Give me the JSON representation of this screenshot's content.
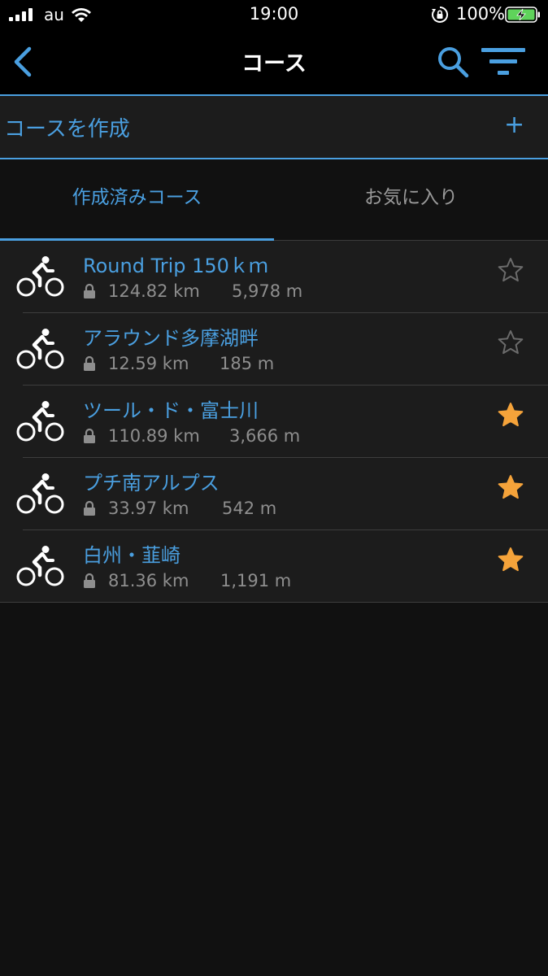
{
  "status_bar": {
    "carrier": "au",
    "time": "19:00",
    "battery_percent": "100%",
    "battery_level": 1.0,
    "icons": [
      "signal-icon",
      "wifi-icon",
      "orientation-lock-icon",
      "battery-charging-icon"
    ]
  },
  "nav": {
    "title": "コース",
    "icons": [
      "back-chevron-icon",
      "search-icon",
      "filter-icon"
    ]
  },
  "create": {
    "label": "コースを作成",
    "plus": "+"
  },
  "tabs": [
    {
      "label": "作成済みコース",
      "active": true
    },
    {
      "label": "お気に入り",
      "active": false
    }
  ],
  "courses": [
    {
      "name": "Round Trip 150ｋｍ",
      "distance": "124.82 km",
      "elevation": "5,978 m",
      "favorite": false
    },
    {
      "name": "アラウンド多摩湖畔",
      "distance": "12.59 km",
      "elevation": "185 m",
      "favorite": false
    },
    {
      "name": "ツール・ド・富士川",
      "distance": "110.89 km",
      "elevation": "3,666 m",
      "favorite": true
    },
    {
      "name": "プチ南アルプス",
      "distance": "33.97 km",
      "elevation": "542 m",
      "favorite": true
    },
    {
      "name": "白州・韮崎",
      "distance": "81.36 km",
      "elevation": "1,191 m",
      "favorite": true
    }
  ],
  "colors": {
    "accent": "#4a9fe0",
    "star_active": "#f5a33a",
    "star_inactive": "#6b6b6b",
    "meta_text": "#8e8e8e",
    "battery_green": "#5fd35b"
  }
}
